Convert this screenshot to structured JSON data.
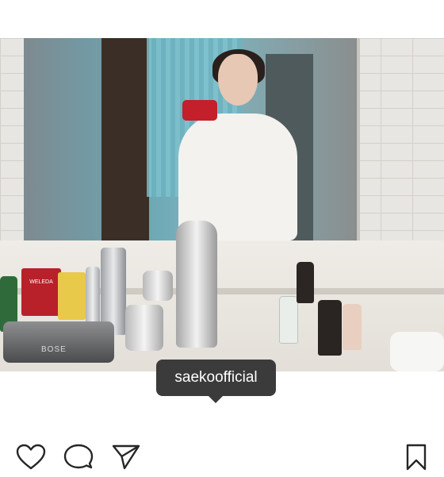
{
  "post": {
    "photo_description_icon": "photo",
    "tag_username": "saekoofficial",
    "brand_box_label": "WELEDA",
    "speaker_label": "BOSE"
  },
  "actions": {
    "like_icon": "heart-outline-icon",
    "comment_icon": "comment-bubble-icon",
    "share_icon": "paper-plane-icon",
    "save_icon": "bookmark-icon"
  },
  "colors": {
    "tooltip_bg": "#3b3b3b",
    "icon_stroke": "#262626",
    "background": "#ffffff"
  }
}
